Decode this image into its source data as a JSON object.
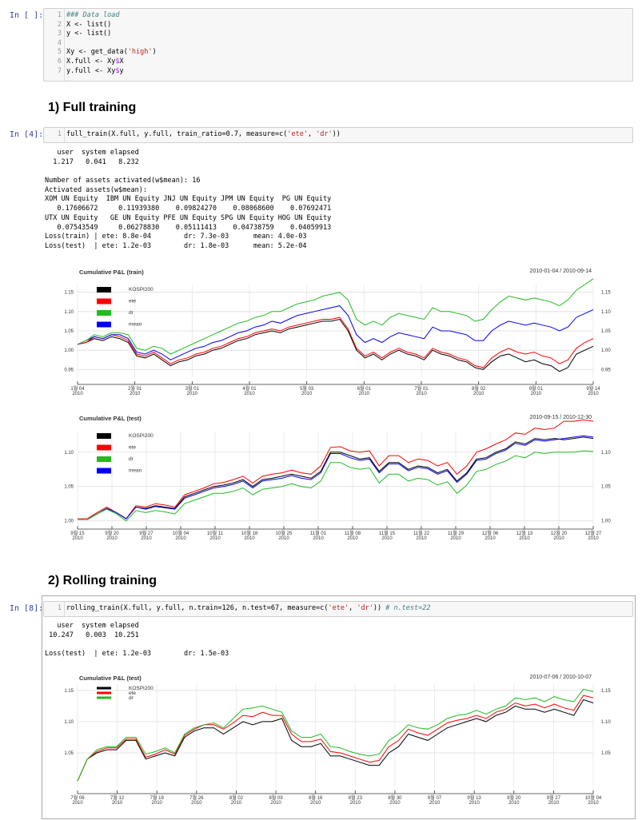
{
  "cell1": {
    "prompt": "In [ ]:",
    "lines": [
      "1",
      "2",
      "3",
      "4",
      "5",
      "6",
      "7"
    ],
    "code": [
      {
        "t": "### Data load",
        "c": "cm"
      },
      {
        "t": "X <- list()",
        "c": ""
      },
      {
        "t": "y <- list()",
        "c": ""
      },
      {
        "t": "",
        "c": ""
      },
      {
        "t": "Xy <- get_data('high')",
        "c": ""
      },
      {
        "t": "X.full <- Xy$X",
        "c": ""
      },
      {
        "t": "y.full <- Xy$y",
        "c": ""
      }
    ]
  },
  "heading1": "1) Full training",
  "cell2": {
    "prompt": "In [4]:",
    "lines": [
      "1"
    ],
    "code": "full_train(X.full, y.full, train_ratio=0.7, measure=c('ete', 'dr'))"
  },
  "output2": [
    "   user  system elapsed",
    "  1.217   0.041   8.232",
    "",
    "Number of assets activated(w$mean): 16",
    "Activated assets(w$mean):",
    "XOM UN Equity  IBM UN Equity JNJ UN Equity JPM UN Equity  PG UN Equity",
    "   0.17606672     0.11939380    0.09824270    0.08068600    0.07692471",
    "UTX UN Equity   GE UN Equity PFE UN Equity SPG UN Equity HOG UN Equity",
    "   0.07543549     0.06278830    0.05111413    0.04738759    0.04059913",
    "Loss(train) | ete: 8.8e-04        dr: 7.3e-03      mean: 4.0e-03",
    "Loss(test)  | ete: 1.2e-03        dr: 1.8e-03      mean: 5.2e-04"
  ],
  "heading2": "2) Rolling training",
  "cell3": {
    "prompt": "In [8]:",
    "lines": [
      "1"
    ],
    "code": "rolling_train(X.full, y.full, n.train=126, n.test=67, measure=c('ete', 'dr'))",
    "comment": " # n.test=22"
  },
  "output3": [
    "   user  system elapsed",
    " 10.247   0.003  10.251",
    "",
    "Loss(test)  | ete: 1.2e-03        dr: 1.5e-03"
  ],
  "colors": {
    "KOSPI200": "#000000",
    "ete": "#ff0000",
    "dr": "#22bb22",
    "mean": "#0000ee"
  },
  "chart_data": [
    {
      "type": "line",
      "title": "Cumulative P&L (train)",
      "range": "2010-01-04 / 2010-09-14",
      "legend": [
        "KOSPI200",
        "ete",
        "dr",
        "mean"
      ],
      "yticks": [
        "1.15",
        "1.10",
        "1.05",
        "1.00",
        "0.95"
      ],
      "ylim": [
        0.93,
        1.17
      ],
      "xticks": [
        [
          "1월 04",
          "2010"
        ],
        [
          "2월 01",
          "2010"
        ],
        [
          "3월 01",
          "2010"
        ],
        [
          "4월 01",
          "2010"
        ],
        [
          "5월 03",
          "2010"
        ],
        [
          "6월 01",
          "2010"
        ],
        [
          "7월 01",
          "2010"
        ],
        [
          "8월 02",
          "2010"
        ],
        [
          "9월 01",
          "2010"
        ],
        [
          "9월 14",
          "2010"
        ]
      ],
      "series": [
        {
          "name": "KOSPI200",
          "values": [
            1.015,
            1.02,
            1.03,
            1.025,
            1.035,
            1.03,
            1.02,
            0.985,
            0.98,
            0.99,
            0.975,
            0.96,
            0.97,
            0.975,
            0.985,
            0.99,
            1.0,
            1.005,
            1.015,
            1.025,
            1.03,
            1.04,
            1.045,
            1.05,
            1.045,
            1.055,
            1.06,
            1.065,
            1.07,
            1.075,
            1.075,
            1.08,
            1.05,
            1.0,
            0.98,
            0.99,
            0.975,
            0.99,
            1.0,
            0.99,
            0.985,
            0.975,
            1.0,
            0.99,
            0.985,
            0.975,
            0.97,
            0.955,
            0.95,
            0.97,
            0.985,
            0.99,
            0.98,
            0.97,
            0.975,
            0.965,
            0.96,
            0.945,
            0.955,
            0.99,
            1.0,
            1.01
          ]
        },
        {
          "name": "ete",
          "values": [
            1.015,
            1.02,
            1.035,
            1.03,
            1.04,
            1.035,
            1.025,
            0.99,
            0.985,
            0.995,
            0.98,
            0.965,
            0.975,
            0.98,
            0.99,
            0.995,
            1.005,
            1.01,
            1.02,
            1.03,
            1.035,
            1.045,
            1.05,
            1.055,
            1.05,
            1.06,
            1.065,
            1.07,
            1.075,
            1.08,
            1.08,
            1.085,
            1.055,
            1.005,
            0.985,
            0.995,
            0.98,
            0.995,
            1.005,
            0.995,
            0.99,
            0.98,
            1.005,
            0.995,
            0.99,
            0.98,
            0.975,
            0.96,
            0.955,
            0.98,
            0.995,
            1.005,
            0.995,
            0.99,
            0.995,
            0.985,
            0.98,
            0.965,
            0.975,
            1.005,
            1.02,
            1.03
          ]
        },
        {
          "name": "mean",
          "values": [
            1.015,
            1.025,
            1.035,
            1.03,
            1.04,
            1.04,
            1.03,
            0.995,
            0.99,
            1.0,
            0.99,
            0.975,
            0.985,
            0.995,
            1.005,
            1.01,
            1.02,
            1.025,
            1.035,
            1.045,
            1.05,
            1.06,
            1.065,
            1.075,
            1.07,
            1.08,
            1.09,
            1.095,
            1.1,
            1.105,
            1.11,
            1.115,
            1.09,
            1.04,
            1.02,
            1.03,
            1.02,
            1.035,
            1.045,
            1.04,
            1.035,
            1.03,
            1.06,
            1.05,
            1.05,
            1.045,
            1.04,
            1.025,
            1.025,
            1.05,
            1.065,
            1.075,
            1.07,
            1.065,
            1.07,
            1.065,
            1.06,
            1.05,
            1.06,
            1.085,
            1.095,
            1.105
          ]
        },
        {
          "name": "dr",
          "values": [
            1.015,
            1.025,
            1.04,
            1.035,
            1.045,
            1.045,
            1.04,
            1.005,
            1.0,
            1.01,
            1.005,
            0.99,
            1.0,
            1.01,
            1.02,
            1.03,
            1.04,
            1.05,
            1.06,
            1.07,
            1.075,
            1.085,
            1.09,
            1.1,
            1.1,
            1.11,
            1.12,
            1.125,
            1.13,
            1.14,
            1.145,
            1.15,
            1.13,
            1.08,
            1.065,
            1.075,
            1.065,
            1.085,
            1.095,
            1.09,
            1.085,
            1.08,
            1.11,
            1.1,
            1.1,
            1.095,
            1.09,
            1.075,
            1.08,
            1.105,
            1.125,
            1.14,
            1.135,
            1.13,
            1.135,
            1.13,
            1.125,
            1.115,
            1.13,
            1.155,
            1.17,
            1.185
          ]
        }
      ]
    },
    {
      "type": "line",
      "title": "Cumulative P&L (test)",
      "range": "2010-09-15 / 2010-12-30",
      "legend": [
        "KOSPI200",
        "ete",
        "dr",
        "mean"
      ],
      "yticks": [
        "1.10",
        "1.05",
        "1.00"
      ],
      "ylim": [
        0.995,
        1.13
      ],
      "xticks": [
        [
          "9월 15",
          "2010"
        ],
        [
          "9월 20",
          "2010"
        ],
        [
          "9월 27",
          "2010"
        ],
        [
          "10월 04",
          "2010"
        ],
        [
          "10월 11",
          "2010"
        ],
        [
          "10월 18",
          "2010"
        ],
        [
          "10월 25",
          "2010"
        ],
        [
          "11월 01",
          "2010"
        ],
        [
          "11월 08",
          "2010"
        ],
        [
          "11월 15",
          "2010"
        ],
        [
          "11월 22",
          "2010"
        ],
        [
          "11월 29",
          "2010"
        ],
        [
          "12월 06",
          "2010"
        ],
        [
          "12월 13",
          "2010"
        ],
        [
          "12월 20",
          "2010"
        ],
        [
          "12월 27",
          "2010"
        ]
      ],
      "series": [
        {
          "name": "KOSPI200",
          "values": [
            1.002,
            1.002,
            1.01,
            1.018,
            1.012,
            1.003,
            1.02,
            1.018,
            1.022,
            1.02,
            1.018,
            1.035,
            1.04,
            1.045,
            1.05,
            1.052,
            1.055,
            1.06,
            1.05,
            1.06,
            1.062,
            1.065,
            1.068,
            1.065,
            1.062,
            1.072,
            1.1,
            1.1,
            1.095,
            1.09,
            1.092,
            1.072,
            1.085,
            1.085,
            1.075,
            1.08,
            1.078,
            1.07,
            1.075,
            1.058,
            1.07,
            1.09,
            1.092,
            1.1,
            1.105,
            1.115,
            1.112,
            1.12,
            1.118,
            1.12,
            1.118,
            1.12,
            1.122,
            1.12
          ]
        },
        {
          "name": "ete",
          "values": [
            1.003,
            1.003,
            1.012,
            1.02,
            1.012,
            1.003,
            1.022,
            1.02,
            1.025,
            1.023,
            1.02,
            1.038,
            1.043,
            1.048,
            1.054,
            1.056,
            1.06,
            1.065,
            1.055,
            1.065,
            1.068,
            1.07,
            1.074,
            1.07,
            1.068,
            1.08,
            1.107,
            1.108,
            1.102,
            1.1,
            1.102,
            1.08,
            1.095,
            1.095,
            1.085,
            1.09,
            1.088,
            1.08,
            1.085,
            1.068,
            1.08,
            1.1,
            1.105,
            1.112,
            1.118,
            1.128,
            1.126,
            1.135,
            1.133,
            1.135,
            1.145,
            1.145,
            1.147,
            1.145
          ]
        },
        {
          "name": "mean",
          "values": [
            1.002,
            1.002,
            1.01,
            1.018,
            1.012,
            1.003,
            1.02,
            1.017,
            1.021,
            1.019,
            1.017,
            1.033,
            1.038,
            1.043,
            1.048,
            1.05,
            1.053,
            1.058,
            1.048,
            1.058,
            1.06,
            1.062,
            1.066,
            1.062,
            1.06,
            1.07,
            1.098,
            1.098,
            1.092,
            1.088,
            1.09,
            1.07,
            1.083,
            1.083,
            1.073,
            1.078,
            1.076,
            1.068,
            1.073,
            1.056,
            1.068,
            1.088,
            1.09,
            1.098,
            1.103,
            1.113,
            1.11,
            1.118,
            1.116,
            1.118,
            1.12,
            1.122,
            1.124,
            1.122
          ]
        },
        {
          "name": "dr",
          "values": [
            1.002,
            1.002,
            1.01,
            1.017,
            1.01,
            1.0,
            1.015,
            1.012,
            1.015,
            1.013,
            1.01,
            1.025,
            1.03,
            1.035,
            1.04,
            1.04,
            1.043,
            1.048,
            1.038,
            1.046,
            1.048,
            1.05,
            1.054,
            1.05,
            1.048,
            1.058,
            1.085,
            1.085,
            1.078,
            1.075,
            1.077,
            1.055,
            1.068,
            1.068,
            1.058,
            1.062,
            1.06,
            1.052,
            1.057,
            1.04,
            1.052,
            1.072,
            1.075,
            1.082,
            1.087,
            1.095,
            1.092,
            1.1,
            1.098,
            1.1,
            1.1,
            1.1,
            1.102,
            1.101
          ]
        }
      ]
    },
    {
      "type": "line",
      "title": "Cumulative P&L (test)",
      "range": "2010-07-06 / 2010-10-07",
      "legend": [
        "KOSPI200",
        "ete",
        "dr"
      ],
      "yticks": [
        "1.15",
        "1.10",
        "1.05"
      ],
      "ylim": [
        0.995,
        1.16
      ],
      "xticks": [
        [
          "7월 06",
          "2010"
        ],
        [
          "7월 12",
          "2010"
        ],
        [
          "7월 19",
          "2010"
        ],
        [
          "7월 26",
          "2010"
        ],
        [
          "8월 02",
          "2010"
        ],
        [
          "8월 09",
          "2010"
        ],
        [
          "8월 16",
          "2010"
        ],
        [
          "8월 23",
          "2010"
        ],
        [
          "8월 30",
          "2010"
        ],
        [
          "9월 07",
          "2010"
        ],
        [
          "9월 13",
          "2010"
        ],
        [
          "9월 20",
          "2010"
        ],
        [
          "9월 27",
          "2010"
        ],
        [
          "10월 04",
          "2010"
        ]
      ],
      "series": [
        {
          "name": "KOSPI200",
          "values": [
            1.005,
            1.04,
            1.05,
            1.055,
            1.055,
            1.07,
            1.07,
            1.04,
            1.045,
            1.05,
            1.045,
            1.075,
            1.085,
            1.09,
            1.09,
            1.08,
            1.09,
            1.1,
            1.095,
            1.1,
            1.1,
            1.105,
            1.07,
            1.06,
            1.06,
            1.065,
            1.045,
            1.045,
            1.04,
            1.035,
            1.03,
            1.03,
            1.05,
            1.06,
            1.08,
            1.075,
            1.07,
            1.08,
            1.09,
            1.095,
            1.1,
            1.105,
            1.1,
            1.11,
            1.115,
            1.125,
            1.12,
            1.12,
            1.115,
            1.12,
            1.115,
            1.11,
            1.135,
            1.13
          ]
        },
        {
          "name": "ete",
          "values": [
            1.005,
            1.04,
            1.052,
            1.058,
            1.058,
            1.072,
            1.072,
            1.043,
            1.048,
            1.055,
            1.048,
            1.078,
            1.088,
            1.095,
            1.095,
            1.088,
            1.098,
            1.11,
            1.108,
            1.115,
            1.11,
            1.11,
            1.08,
            1.068,
            1.068,
            1.072,
            1.052,
            1.05,
            1.045,
            1.04,
            1.035,
            1.038,
            1.06,
            1.07,
            1.088,
            1.082,
            1.078,
            1.088,
            1.098,
            1.102,
            1.105,
            1.11,
            1.105,
            1.115,
            1.12,
            1.13,
            1.125,
            1.128,
            1.122,
            1.128,
            1.122,
            1.118,
            1.142,
            1.138
          ]
        },
        {
          "name": "dr",
          "values": [
            1.005,
            1.04,
            1.055,
            1.06,
            1.06,
            1.075,
            1.075,
            1.048,
            1.052,
            1.058,
            1.05,
            1.08,
            1.09,
            1.095,
            1.098,
            1.09,
            1.105,
            1.12,
            1.122,
            1.125,
            1.12,
            1.115,
            1.085,
            1.075,
            1.075,
            1.08,
            1.06,
            1.058,
            1.052,
            1.048,
            1.045,
            1.048,
            1.07,
            1.08,
            1.095,
            1.09,
            1.088,
            1.095,
            1.105,
            1.11,
            1.112,
            1.118,
            1.112,
            1.12,
            1.125,
            1.138,
            1.135,
            1.138,
            1.132,
            1.14,
            1.135,
            1.132,
            1.152,
            1.148
          ]
        }
      ]
    }
  ]
}
